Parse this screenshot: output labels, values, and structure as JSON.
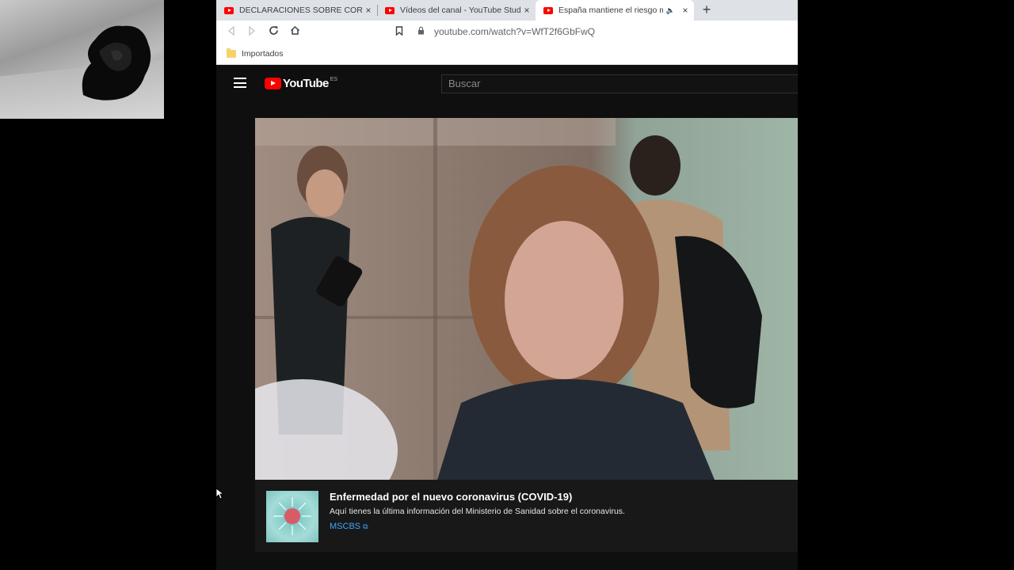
{
  "tabs": [
    {
      "title": "DECLARACIONES SOBRE CORONAVIRUS",
      "close": "×",
      "active": false
    },
    {
      "title": "Vídeos del canal - YouTube Studio",
      "close": "×",
      "active": false
    },
    {
      "title": "España mantiene el riesgo moderado",
      "close": "×",
      "active": true,
      "audio": "🔈"
    }
  ],
  "new_tab": "+",
  "toolbar": {
    "back_icon": "arrow-left-icon",
    "forward_icon": "arrow-right-icon",
    "reload_icon": "reload-icon",
    "home_icon": "home-icon",
    "bookmark_icon": "bookmark-icon",
    "lock_icon": "lock-icon",
    "url": "youtube.com/watch?v=WfT2f6GbFwQ"
  },
  "bookmarks_bar": {
    "folder_label": "Importados"
  },
  "youtube": {
    "logo_text": "YouTube",
    "country_code": "ES",
    "search_placeholder": "Buscar",
    "brand_red": "#ff0000"
  },
  "info_panel": {
    "title": "Enfermedad por el nuevo coronavirus (COVID-19)",
    "description": "Aquí tienes la última información del Ministerio de Sanidad sobre el coronavirus.",
    "link_label": "MSCBS",
    "link_color": "#3ea6ff"
  }
}
